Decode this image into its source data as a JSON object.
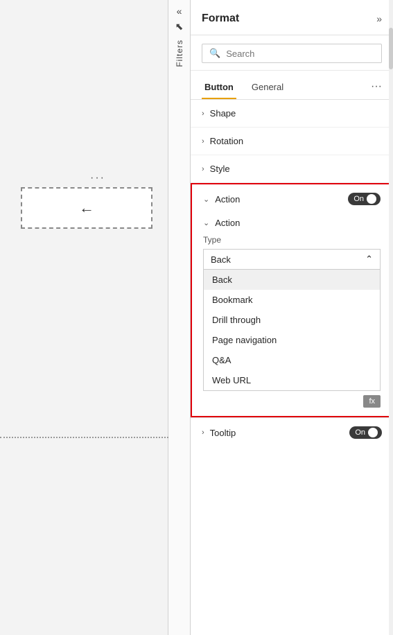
{
  "canvas": {
    "ellipsis": "···"
  },
  "filters_sidebar": {
    "label": "Filters",
    "chevron_left": "«",
    "funnel": "⊲"
  },
  "format_panel": {
    "title": "Format",
    "chevron_right": "»",
    "search": {
      "placeholder": "Search"
    },
    "tabs": [
      {
        "label": "Button",
        "active": true
      },
      {
        "label": "General",
        "active": false
      }
    ],
    "tabs_more": "···",
    "sections": [
      {
        "label": "Shape"
      },
      {
        "label": "Rotation"
      },
      {
        "label": "Style"
      }
    ],
    "action_section": {
      "label": "Action",
      "toggle_label": "On",
      "sub_section": {
        "label": "Action",
        "type_label": "Type",
        "dropdown": {
          "selected": "Back",
          "options": [
            {
              "value": "Back",
              "selected": true
            },
            {
              "value": "Bookmark",
              "selected": false
            },
            {
              "value": "Drill through",
              "selected": false
            },
            {
              "value": "Page navigation",
              "selected": false
            },
            {
              "value": "Q&A",
              "selected": false
            },
            {
              "value": "Web URL",
              "selected": false
            }
          ]
        },
        "fx_button": "fx"
      }
    },
    "tooltip_section": {
      "label": "Tooltip",
      "toggle_label": "On"
    }
  }
}
